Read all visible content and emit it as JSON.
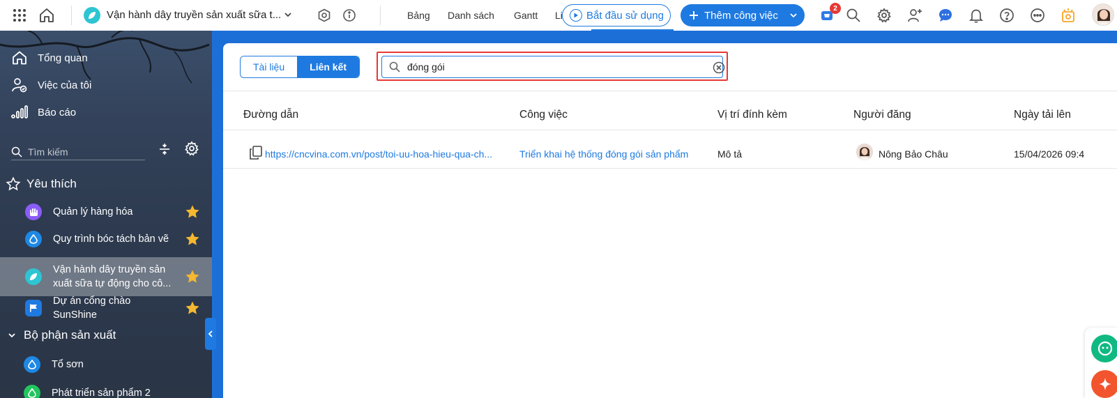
{
  "topbar": {
    "project_title": "Vận hành dây truyền sản xuất sữa t...",
    "view_tabs": [
      "Bảng",
      "Danh sách",
      "Gantt",
      "Li"
    ],
    "start_button": "Bắt đầu sử dụng",
    "add_button": "Thêm công việc",
    "cart_badge": "2",
    "icons": [
      "apps-grid-icon",
      "home-icon",
      "chevron-down-icon",
      "project-settings-icon",
      "info-icon",
      "cart-icon",
      "search-icon",
      "gear-icon",
      "add-user-icon",
      "chat-icon",
      "bell-icon",
      "help-icon",
      "more-icon",
      "daily-sun-icon",
      "avatar"
    ]
  },
  "sidebar": {
    "main_items": [
      {
        "label": "Tổng quan",
        "icon": "home-icon"
      },
      {
        "label": "Việc của tôi",
        "icon": "my-tasks-icon"
      },
      {
        "label": "Báo cáo",
        "icon": "report-icon"
      }
    ],
    "search_placeholder": "Tìm kiếm",
    "favorites_title": "Yêu thích",
    "favorites": [
      {
        "label": "Quản lý hàng hóa",
        "color": "#8b5cf6"
      },
      {
        "label": "Quy trình bóc tách bản vẽ",
        "color": "#1e88e5"
      },
      {
        "label": "Vận hành dây truyền sản xuất sữa tự động cho cô...",
        "color": "#2ec5d3",
        "active": true
      },
      {
        "label": "Dự án cổng chào SunShine",
        "color": "#1e7ae0"
      }
    ],
    "department_title": "Bộ phận sản xuất",
    "department_items": [
      {
        "label": "Tổ sơn",
        "color": "#1e88e5"
      },
      {
        "label": "Phát triển sản phẩm 2",
        "color": "#22c55e"
      }
    ]
  },
  "content": {
    "segments": [
      "Tài liệu",
      "Liên kết"
    ],
    "active_segment": "Liên kết",
    "search_value": "đóng gói",
    "columns": [
      "Đường dẫn",
      "Công việc",
      "Vị trí đính kèm",
      "Người đăng",
      "Ngày tải lên"
    ],
    "rows": [
      {
        "url": "https://cncvina.com.vn/post/toi-uu-hoa-hieu-qua-ch...",
        "task": "Triển khai hệ thống đóng gói sản phẩm",
        "location": "Mô tả",
        "poster": "Nông Bảo Châu",
        "uploaded": "15/04/2026 09:4"
      }
    ]
  },
  "colors": {
    "accent": "#1e7ae0",
    "highlight": "#e53935",
    "star": "#f5b82e"
  }
}
